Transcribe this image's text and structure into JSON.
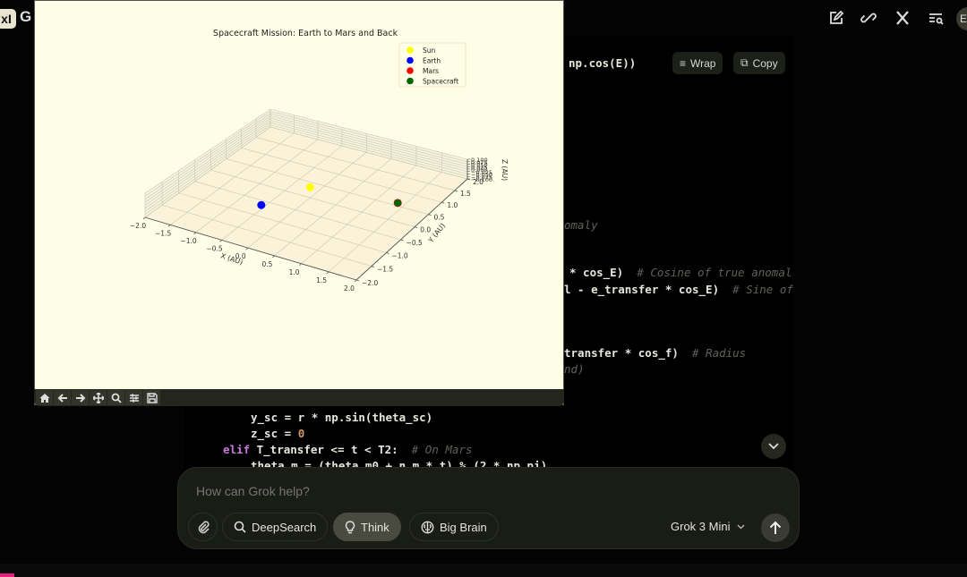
{
  "app": {
    "logo": "xI",
    "title_initial": "G",
    "avatar_initial": "E"
  },
  "header_icons": [
    "edit-icon",
    "link-icon",
    "x-logo-icon",
    "search-list-icon"
  ],
  "code": {
    "wrap_label": "Wrap",
    "copy_label": "Copy",
    "lines": [
      {
        "code": "np.cos(E))",
        "comment": ""
      },
      {
        "code": "",
        "comment": "omaly"
      },
      {
        "code": "* cos_E)",
        "comment": "# Cosine of true anomal"
      },
      {
        "code": "l - e_transfer * cos_E)",
        "comment": "# Sine of"
      },
      {
        "code": "transfer * cos_f)",
        "comment": "# Radius"
      },
      {
        "code": "",
        "comment": "nd)"
      },
      {
        "code": "y_sc = r * np.sin(theta_sc)",
        "comment": ""
      },
      {
        "code": "z_sc = ",
        "num": "0",
        "comment": ""
      },
      {
        "kw": "elif",
        "code": " T_transfer <= t < T2:",
        "comment": "# On Mars"
      },
      {
        "code": "theta_m = (theta_m0 + n_m * t) % (2 * np.pi)",
        "comment": ""
      }
    ]
  },
  "plot_toolbar": [
    "home-icon",
    "back-icon",
    "forward-icon",
    "pan-icon",
    "zoom-icon",
    "configure-icon",
    "save-icon"
  ],
  "composer": {
    "placeholder": "How can Grok help?",
    "deepsearch": "DeepSearch",
    "think": "Think",
    "bigbrain": "Big Brain",
    "model": "Grok 3 Mini"
  },
  "chart_data": {
    "type": "scatter",
    "projection": "3d",
    "title": "Spacecraft Mission: Earth to Mars and Back",
    "xlabel": "X (AU)",
    "ylabel": "Y (AU)",
    "zlabel": "Z (AU)",
    "xlim": [
      -2,
      2
    ],
    "ylim": [
      -2,
      2
    ],
    "zlim": [
      -0.1,
      0.1
    ],
    "xticks": [
      "−2.0",
      "−1.5",
      "−1.0",
      "−0.5",
      "0.0",
      "0.5",
      "1.0",
      "1.5",
      "2.0"
    ],
    "yticks": [
      "−2.0",
      "−1.5",
      "−1.0",
      "−0.5",
      "0.0",
      "0.5",
      "1.0",
      "1.5",
      "2.0"
    ],
    "zticks": [
      "−0.100",
      "−0.075",
      "−0.050",
      "−0.025",
      "0.000",
      "0.025",
      "0.050",
      "0.075",
      "0.100"
    ],
    "grid": true,
    "legend": "top-right",
    "series": [
      {
        "name": "Sun",
        "color": "#ffff00",
        "x": 0,
        "y": 0,
        "z": 0,
        "size": 8
      },
      {
        "name": "Earth",
        "color": "#0000ff",
        "x": -0.37,
        "y": -0.98,
        "z": 0,
        "size": 8
      },
      {
        "name": "Mars",
        "color": "#ff0000",
        "x": 1.54,
        "y": 0.27,
        "z": 0,
        "size": 8
      },
      {
        "name": "Spacecraft",
        "color": "#006400",
        "x": 1.54,
        "y": 0.27,
        "z": 0,
        "size": 7
      }
    ]
  }
}
